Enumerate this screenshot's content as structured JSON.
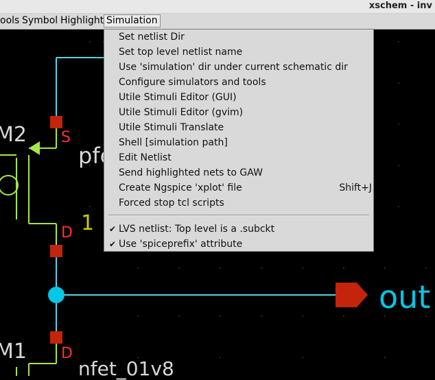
{
  "window": {
    "title": "xschem - inv"
  },
  "menubar": {
    "items": [
      {
        "label": "ools"
      },
      {
        "label": "Symbol"
      },
      {
        "label": "Highlight"
      },
      {
        "label": "Simulation"
      }
    ]
  },
  "simulation_menu": {
    "items": [
      {
        "label": "Set netlist Dir",
        "shortcut": ""
      },
      {
        "label": "Set top level netlist name",
        "shortcut": ""
      },
      {
        "label": "Use 'simulation' dir under current schematic dir",
        "shortcut": ""
      },
      {
        "label": "Configure simulators and tools",
        "shortcut": ""
      },
      {
        "label": "Utile Stimuli Editor (GUI)",
        "shortcut": ""
      },
      {
        "label": "Utile Stimuli Editor (gvim)",
        "shortcut": ""
      },
      {
        "label": "Utile Stimuli Translate",
        "shortcut": ""
      },
      {
        "label": "Shell [simulation path]",
        "shortcut": ""
      },
      {
        "label": "Edit Netlist",
        "shortcut": ""
      },
      {
        "label": "Send highlighted nets to GAW",
        "shortcut": ""
      },
      {
        "label": "Create Ngspice 'xplot' file",
        "shortcut": "Shift+J"
      },
      {
        "label": "Forced stop tcl scripts",
        "shortcut": ""
      }
    ],
    "check_items": [
      {
        "label": "LVS netlist: Top level is a .subckt",
        "checked": true,
        "mark": "✔"
      },
      {
        "label": "Use 'spiceprefix' attribute",
        "checked": true,
        "mark": "✔"
      }
    ]
  },
  "schematic": {
    "labels": {
      "m2": "M2",
      "m1": "M1",
      "s": "S",
      "d_top": "D",
      "d_bottom": "D",
      "pfet": "pfe",
      "nfet": "nfet_01v8",
      "one": "1",
      "out": "out"
    },
    "colors": {
      "wire": "#5ad2e6",
      "device": "#a8e64a",
      "pin": "#d22b12",
      "pin_text": "#ff2f2f",
      "label": "#d8d8d8",
      "param": "#cccc00",
      "out_label": "#00c8e6",
      "grid": "#2a2a2a"
    }
  }
}
